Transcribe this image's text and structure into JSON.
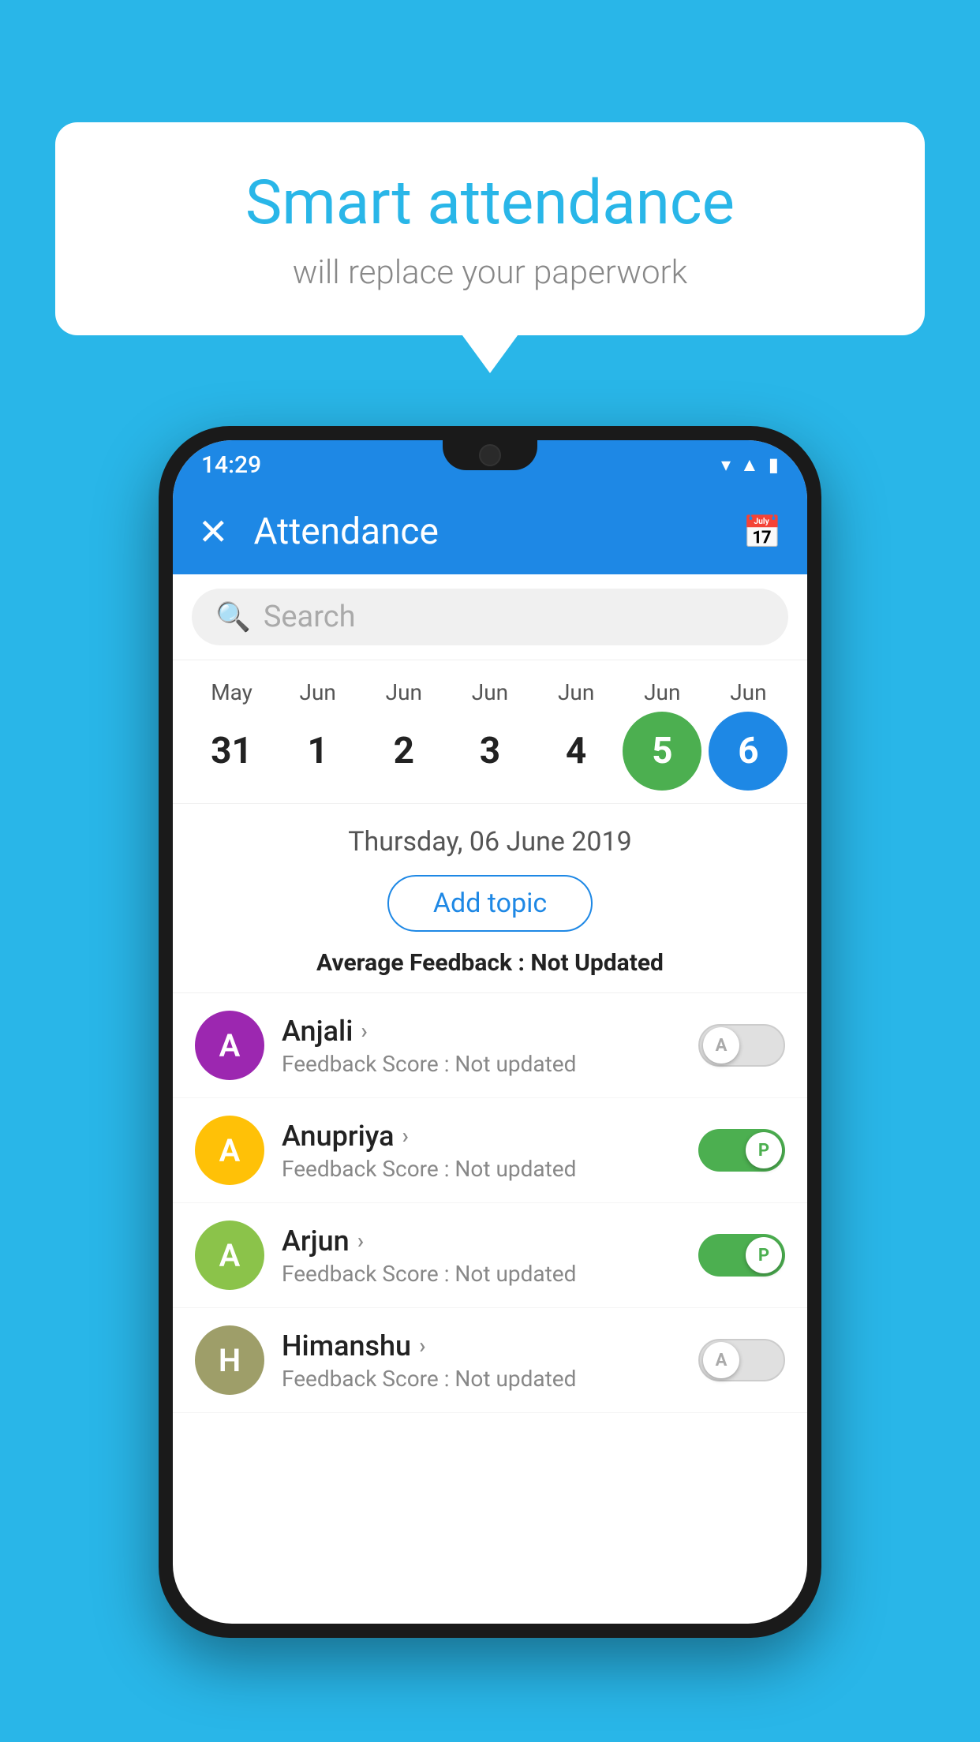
{
  "background_color": "#29B6E8",
  "speech_bubble": {
    "title": "Smart attendance",
    "subtitle": "will replace your paperwork"
  },
  "status_bar": {
    "time": "14:29",
    "icons": [
      "wifi",
      "signal",
      "battery"
    ]
  },
  "app_bar": {
    "close_label": "✕",
    "title": "Attendance",
    "calendar_icon": "📅"
  },
  "search": {
    "placeholder": "Search"
  },
  "calendar": {
    "months": [
      "May",
      "Jun",
      "Jun",
      "Jun",
      "Jun",
      "Jun",
      "Jun"
    ],
    "dates": [
      "31",
      "1",
      "2",
      "3",
      "4",
      "5",
      "6"
    ],
    "selected_green": "5",
    "selected_blue": "6"
  },
  "date_info": {
    "label": "Thursday, 06 June 2019",
    "add_topic_label": "Add topic",
    "avg_feedback_label": "Average Feedback : ",
    "avg_feedback_value": "Not Updated"
  },
  "students": [
    {
      "name": "Anjali",
      "initial": "A",
      "avatar_color": "purple",
      "feedback": "Feedback Score : Not updated",
      "toggle_state": "off",
      "toggle_label": "A"
    },
    {
      "name": "Anupriya",
      "initial": "A",
      "avatar_color": "yellow",
      "feedback": "Feedback Score : Not updated",
      "toggle_state": "on",
      "toggle_label": "P"
    },
    {
      "name": "Arjun",
      "initial": "A",
      "avatar_color": "light-green",
      "feedback": "Feedback Score : Not updated",
      "toggle_state": "on",
      "toggle_label": "P"
    },
    {
      "name": "Himanshu",
      "initial": "H",
      "avatar_color": "olive",
      "feedback": "Feedback Score : Not updated",
      "toggle_state": "off",
      "toggle_label": "A"
    }
  ]
}
